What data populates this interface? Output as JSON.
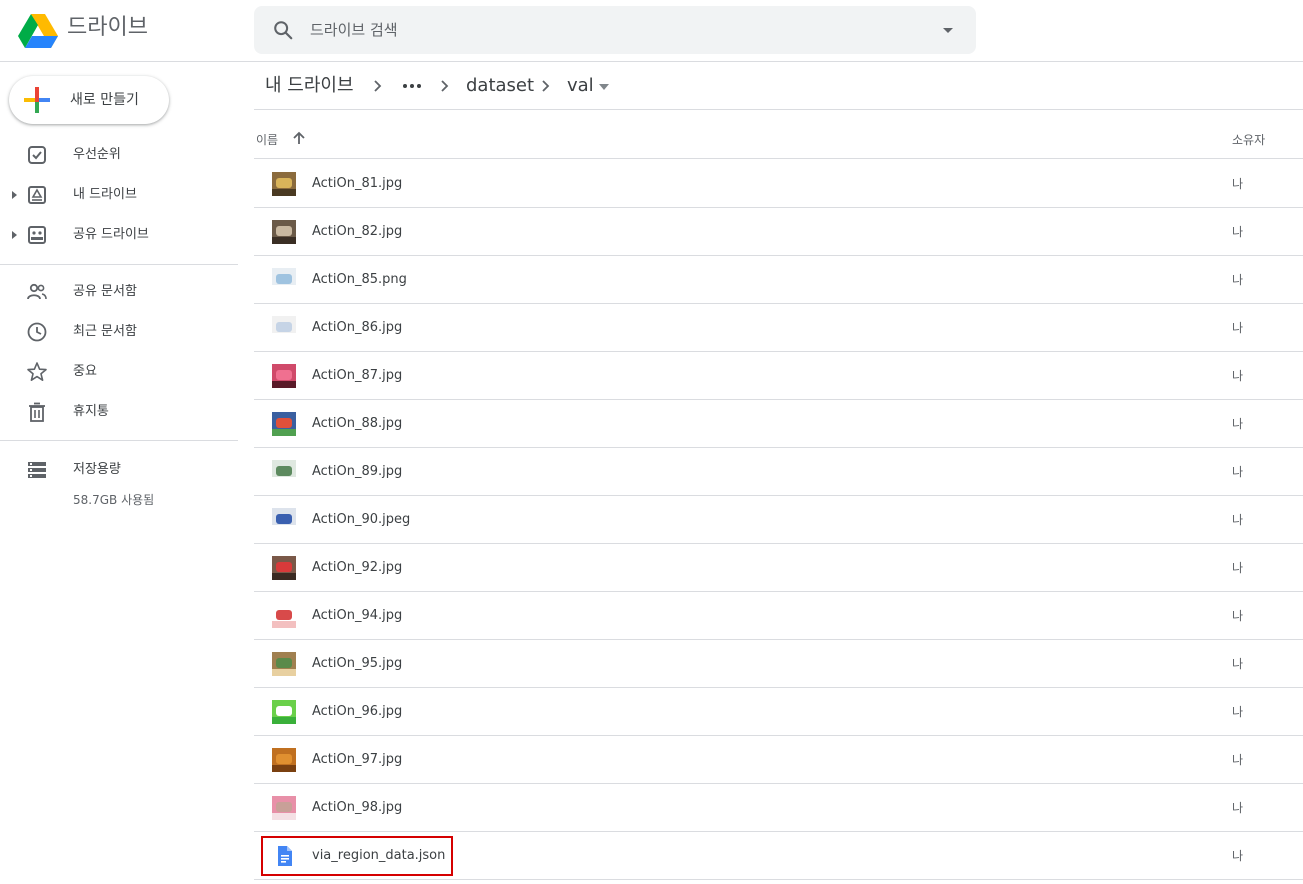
{
  "app": {
    "name": "드라이브"
  },
  "search": {
    "placeholder": "드라이브 검색"
  },
  "sidebar": {
    "new_label": "새로 만들기",
    "items": [
      {
        "label": "우선순위",
        "icon": "priority-check-icon"
      },
      {
        "label": "내 드라이브",
        "icon": "my-drive-icon"
      },
      {
        "label": "공유 드라이브",
        "icon": "shared-drives-icon"
      },
      {
        "label": "공유 문서함",
        "icon": "people-icon"
      },
      {
        "label": "최근 문서함",
        "icon": "clock-icon"
      },
      {
        "label": "중요",
        "icon": "star-icon"
      },
      {
        "label": "휴지통",
        "icon": "trash-icon"
      },
      {
        "label": "저장용량",
        "icon": "storage-icon"
      }
    ],
    "storage_used": "58.7GB 사용됨"
  },
  "breadcrumb": {
    "root": "내 드라이브",
    "parent": "dataset",
    "current": "val"
  },
  "list": {
    "col_name": "이름",
    "col_owner": "소유자",
    "files": [
      {
        "name": "ActiOn_81.jpg",
        "owner": "나",
        "thumb": [
          "#8b6b3d",
          "#d9b45a",
          "#4a3a22"
        ]
      },
      {
        "name": "ActiOn_82.jpg",
        "owner": "나",
        "thumb": [
          "#6b5a48",
          "#c9b8a0",
          "#3a2e24"
        ]
      },
      {
        "name": "ActiOn_85.png",
        "owner": "나",
        "thumb": [
          "#e8eef3",
          "#9fc3e0",
          "#ffffff"
        ]
      },
      {
        "name": "ActiOn_86.jpg",
        "owner": "나",
        "thumb": [
          "#f1f1f1",
          "#c6d4e6",
          "#ffffff"
        ]
      },
      {
        "name": "ActiOn_87.jpg",
        "owner": "나",
        "thumb": [
          "#d04a6a",
          "#f07090",
          "#5a1a28"
        ]
      },
      {
        "name": "ActiOn_88.jpg",
        "owner": "나",
        "thumb": [
          "#3a5fa0",
          "#e0503a",
          "#50a050"
        ]
      },
      {
        "name": "ActiOn_89.jpg",
        "owner": "나",
        "thumb": [
          "#dfe8e0",
          "#5d8a5f",
          "#ffffff"
        ]
      },
      {
        "name": "ActiOn_90.jpeg",
        "owner": "나",
        "thumb": [
          "#dde3ec",
          "#3a60b0",
          "#ffffff"
        ]
      },
      {
        "name": "ActiOn_92.jpg",
        "owner": "나",
        "thumb": [
          "#7a5848",
          "#d83a3a",
          "#3a2a22"
        ]
      },
      {
        "name": "ActiOn_94.jpg",
        "owner": "나",
        "thumb": [
          "#ffffff",
          "#d84a4a",
          "#f3c0c0"
        ]
      },
      {
        "name": "ActiOn_95.jpg",
        "owner": "나",
        "thumb": [
          "#a08050",
          "#5a8a4a",
          "#e8d0a0"
        ]
      },
      {
        "name": "ActiOn_96.jpg",
        "owner": "나",
        "thumb": [
          "#6ad04a",
          "#ffffff",
          "#3ab03a"
        ]
      },
      {
        "name": "ActiOn_97.jpg",
        "owner": "나",
        "thumb": [
          "#c07020",
          "#e09030",
          "#7a4010"
        ]
      },
      {
        "name": "ActiOn_98.jpg",
        "owner": "나",
        "thumb": [
          "#e890a8",
          "#c8a098",
          "#f4e0e4"
        ]
      },
      {
        "name": "via_region_data.json",
        "owner": "나",
        "icon": "google-docs-icon"
      }
    ]
  },
  "colors": {
    "accent_blue": "#4285f4",
    "highlight": "#d50000",
    "divider": "#dadce0"
  }
}
